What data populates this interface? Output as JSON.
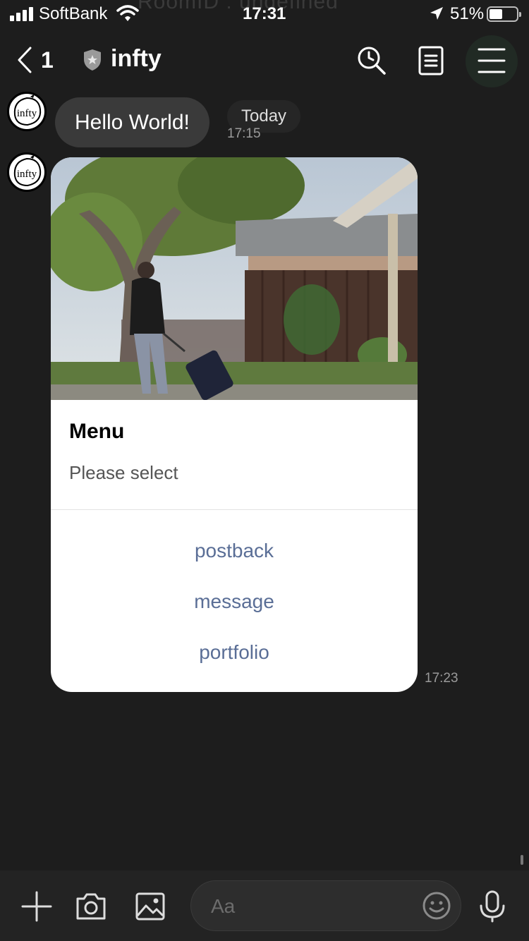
{
  "status_bar": {
    "carrier": "SoftBank",
    "time": "17:31",
    "battery": "51%",
    "ghost_text": "RoomID : undefined",
    "icons": [
      "signal-icon",
      "wifi-icon",
      "location-arrow-icon",
      "battery-icon"
    ]
  },
  "nav": {
    "back_count": "1",
    "title": "infty",
    "icons": [
      "chevron-left-icon",
      "shield-icon",
      "search-clock-icon",
      "notes-icon",
      "hamburger-menu-icon"
    ]
  },
  "chat": {
    "avatar_text": "infty",
    "message_1": {
      "text": "Hello World!",
      "date_chip": "Today",
      "time": "17:15"
    },
    "card": {
      "title": "Menu",
      "subtitle": "Please select",
      "actions": [
        "postback",
        "message",
        "portfolio"
      ],
      "time": "17:23"
    }
  },
  "input_bar": {
    "placeholder": "Aa",
    "icons": [
      "plus-icon",
      "camera-icon",
      "image-icon",
      "emoji-icon",
      "microphone-icon"
    ]
  },
  "colors": {
    "background": "#1d1d1d",
    "bubble": "#3a3a3a",
    "action_link": "#5a6e96",
    "input_bar": "#232323"
  }
}
